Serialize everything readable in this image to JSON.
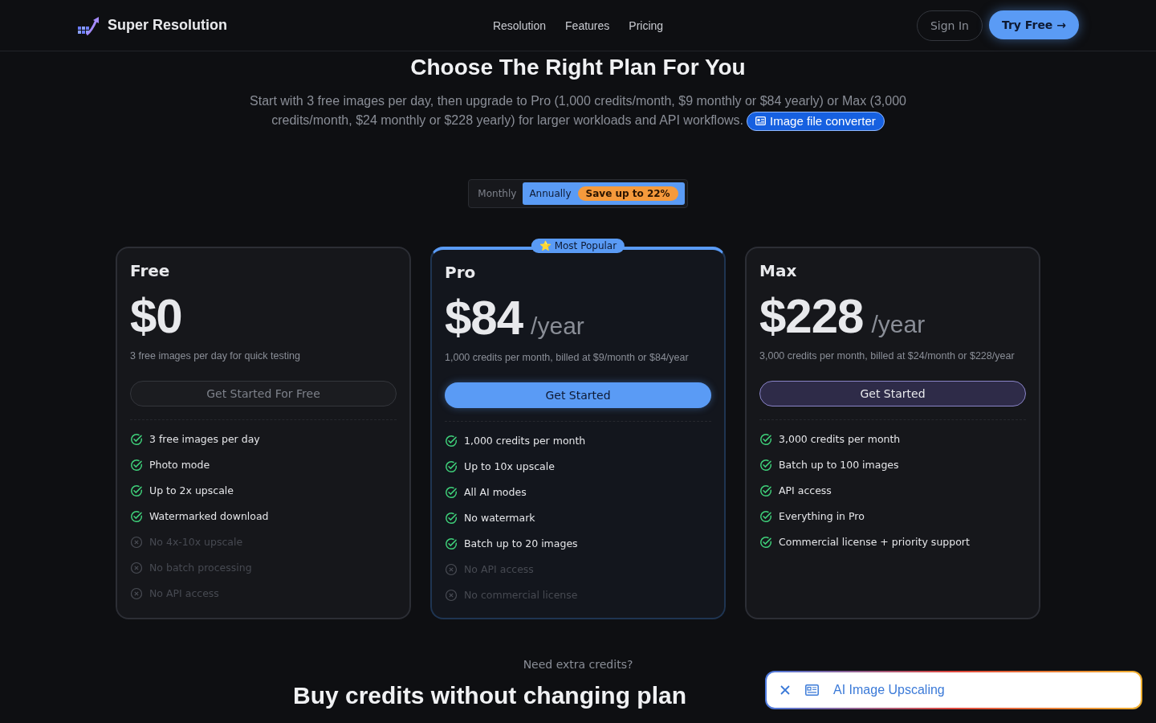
{
  "nav": {
    "brand": "Super Resolution",
    "links": [
      "Resolution",
      "Features",
      "Pricing"
    ],
    "sign_in": "Sign In",
    "try_free": "Try Free →"
  },
  "hero": {
    "heading": "Choose The Right Plan For You",
    "subtitle": "Start with 3 free images per day, then upgrade to Pro (1,000 credits/month, $9 monthly or $84 yearly) or Max (3,000 credits/month, $24 monthly or $228 yearly) for larger workloads and API workflows.",
    "link_chip": "Image file converter"
  },
  "billing_toggle": {
    "options": [
      {
        "label": "Monthly",
        "selected": false
      },
      {
        "label": "Annually",
        "selected": true
      }
    ],
    "badge": "Save up to 22%"
  },
  "plans": [
    {
      "name": "Free",
      "price": "$0",
      "description": "3 free images per day for quick testing",
      "cta": "Get Started For Free",
      "kind": "muted",
      "featured": false,
      "features": [
        {
          "text": "3 free images per day",
          "included": true
        },
        {
          "text": "Photo mode",
          "included": true
        },
        {
          "text": "Up to 2x upscale",
          "included": true
        },
        {
          "text": "Watermarked download",
          "included": true
        },
        {
          "text": "No 4x-10x upscale",
          "included": false
        },
        {
          "text": "No batch processing",
          "included": false
        },
        {
          "text": "No API access",
          "included": false
        }
      ]
    },
    {
      "name": "Pro",
      "price": "$84",
      "period": "/year",
      "description": "1,000 credits per month, billed at $9/month or $84/year",
      "cta": "Get Started",
      "kind": "primary",
      "featured": true,
      "badge": "⭐ Most Popular",
      "features": [
        {
          "text": "1,000 credits per month",
          "included": true
        },
        {
          "text": "Up to 10x upscale",
          "included": true
        },
        {
          "text": "All AI modes",
          "included": true
        },
        {
          "text": "No watermark",
          "included": true
        },
        {
          "text": "Batch up to 20 images",
          "included": true
        },
        {
          "text": "No API access",
          "included": false
        },
        {
          "text": "No commercial license",
          "included": false
        }
      ]
    },
    {
      "name": "Max",
      "price": "$228",
      "period": "/year",
      "description": "3,000 credits per month, billed at $24/month or $228/year",
      "cta": "Get Started",
      "kind": "accent",
      "featured": false,
      "features": [
        {
          "text": "3,000 credits per month",
          "included": true
        },
        {
          "text": "Batch up to 100 images",
          "included": true
        },
        {
          "text": "API access",
          "included": true
        },
        {
          "text": "Everything in Pro",
          "included": true
        },
        {
          "text": "Commercial license + priority support",
          "included": true
        }
      ]
    }
  ],
  "extra": {
    "eyebrow": "Need extra credits?",
    "heading": "Buy credits without changing plan"
  },
  "toast": {
    "label": "AI Image Upscaling"
  }
}
